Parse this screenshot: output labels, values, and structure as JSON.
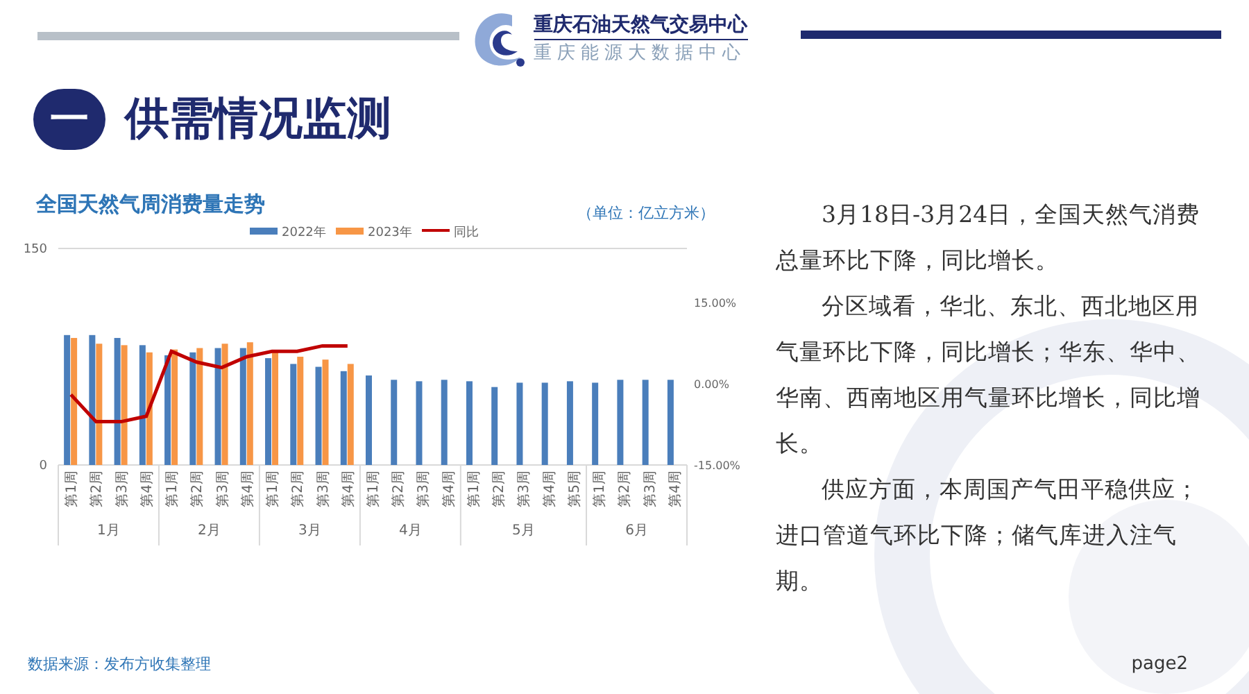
{
  "header": {
    "org_name": "重庆石油天然气交易中心",
    "org_subname": "重庆能源大数据中心"
  },
  "section": {
    "number": "一",
    "title": "供需情况监测"
  },
  "chart_panel": {
    "title": "全国天然气周消费量走势",
    "unit": "（单位：亿立方米）",
    "chart_data": {
      "type": "bar",
      "legend": true,
      "series": [
        {
          "name": "2022年",
          "color": "#4a7ebb",
          "values": [
            90,
            90,
            88,
            83,
            76,
            78,
            81,
            81,
            74,
            70,
            68,
            65,
            62,
            59,
            58,
            59,
            58,
            54,
            57,
            57,
            58,
            57,
            59,
            59,
            59
          ]
        },
        {
          "name": "2023年",
          "color": "#f79646",
          "values": [
            88,
            84,
            83,
            78,
            80,
            81,
            84,
            85,
            78,
            75,
            73,
            70,
            null,
            null,
            null,
            null,
            null,
            null,
            null,
            null,
            null,
            null,
            null,
            null,
            null
          ]
        },
        {
          "name": "同比",
          "color": "#c00000",
          "type": "line",
          "axis": "y2",
          "values": [
            -2,
            -7,
            -7,
            -6,
            6,
            4,
            3,
            5,
            6,
            6,
            7,
            7,
            null,
            null,
            null,
            null,
            null,
            null,
            null,
            null,
            null,
            null,
            null,
            null,
            null
          ]
        }
      ],
      "ylim": [
        0,
        150
      ],
      "yticks": [
        150,
        0
      ],
      "y2lim": [
        -15,
        25
      ],
      "y2ticks": [
        {
          "value": 15,
          "label": "15.00%"
        },
        {
          "value": 0,
          "label": "0.00%"
        },
        {
          "value": -15,
          "label": "-15.00%"
        }
      ]
    },
    "month_groups": [
      {
        "label": "1月",
        "weeks": [
          "第1周",
          "第2周",
          "第3周",
          "第4周"
        ]
      },
      {
        "label": "2月",
        "weeks": [
          "第1周",
          "第2周",
          "第3周",
          "第4周"
        ]
      },
      {
        "label": "3月",
        "weeks": [
          "第1周",
          "第2周",
          "第3周",
          "第4周"
        ]
      },
      {
        "label": "4月",
        "weeks": [
          "第1周",
          "第2周",
          "第3周",
          "第4周"
        ]
      },
      {
        "label": "5月",
        "weeks": [
          "第1周",
          "第2周",
          "第3周",
          "第4周",
          "第5周"
        ]
      },
      {
        "label": "6月",
        "weeks": [
          "第1周",
          "第2周",
          "第3周",
          "第4周"
        ]
      }
    ]
  },
  "paragraphs": [
    "3月18日-3月24日，全国天然气消费总量环比下降，同比增长。",
    "分区域看，华北、东北、西北地区用气量环比下降，同比增长；华东、华中、华南、西南地区用气量环比增长，同比增长。",
    "供应方面，本周国产气田平稳供应；进口管道气环比下降；储气库进入注气期。"
  ],
  "footer": {
    "source": "数据来源：发布方收集整理",
    "page": "page2"
  }
}
